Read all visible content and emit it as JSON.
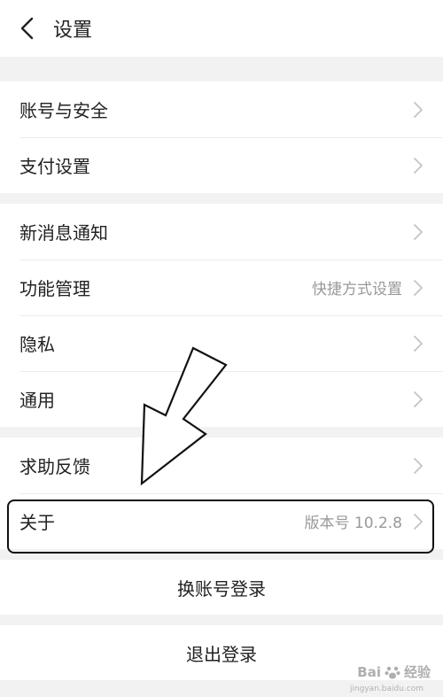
{
  "header": {
    "title": "设置",
    "back_icon": "chevron-left-icon"
  },
  "groups": [
    {
      "items": [
        {
          "label": "账号与安全",
          "value": ""
        },
        {
          "label": "支付设置",
          "value": ""
        }
      ]
    },
    {
      "items": [
        {
          "label": "新消息通知",
          "value": ""
        },
        {
          "label": "功能管理",
          "value": "快捷方式设置"
        },
        {
          "label": "隐私",
          "value": ""
        },
        {
          "label": "通用",
          "value": ""
        }
      ]
    },
    {
      "items": [
        {
          "label": "求助反馈",
          "value": ""
        },
        {
          "label": "关于",
          "value": "版本号 10.2.8"
        }
      ]
    }
  ],
  "actions": {
    "switch_account": "换账号登录",
    "logout": "退出登录"
  },
  "watermark": {
    "brand": "Bai",
    "brand_tail": "经验",
    "sub": "jingyan.baidu.com"
  },
  "colors": {
    "background": "#f2f2f2",
    "card": "#ffffff",
    "text": "#222222",
    "secondary_text": "#999999",
    "chevron": "#c4c4c4"
  }
}
